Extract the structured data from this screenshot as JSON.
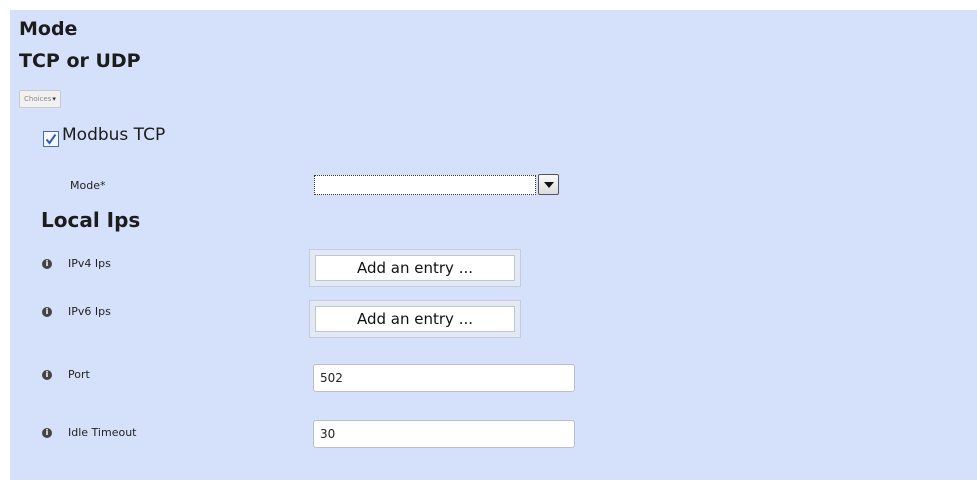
{
  "headings": {
    "mode": "Mode",
    "protocol": "TCP or UDP",
    "local_ips": "Local Ips"
  },
  "choices_button": {
    "label": "Choices",
    "arrow": "▾"
  },
  "modbus_tcp": {
    "label": "Modbus TCP",
    "checked": true
  },
  "mode_field": {
    "label": "Mode*",
    "value": ""
  },
  "ipv4": {
    "label": "IPv4 Ips",
    "button": "Add an entry ..."
  },
  "ipv6": {
    "label": "IPv6 Ips",
    "button": "Add an entry ..."
  },
  "port": {
    "label": "Port",
    "value": "502"
  },
  "idle_timeout": {
    "label": "Idle Timeout",
    "value": "30"
  },
  "icons": {
    "info": "info-icon",
    "check": "check-icon",
    "dropdown": "dropdown-arrow-icon"
  },
  "colors": {
    "panel_background": "#d5e1fb",
    "checkbox_border": "#3f6db0",
    "check_mark": "#2a5fb0"
  }
}
